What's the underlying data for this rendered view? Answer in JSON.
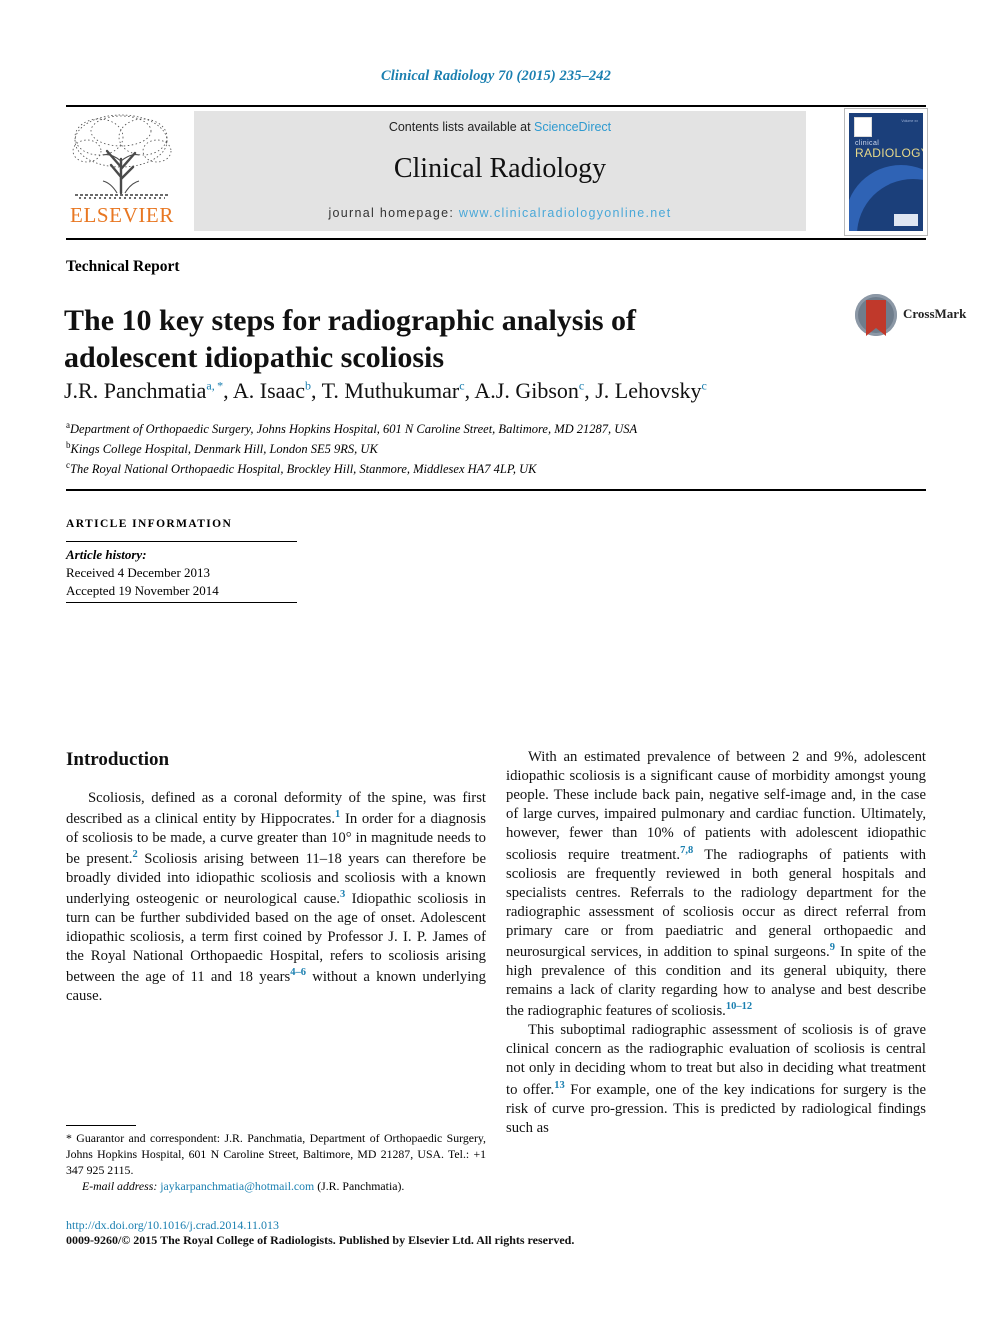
{
  "running_head": "Clinical Radiology 70 (2015) 235–242",
  "masthead": {
    "publisher_name": "ELSEVIER",
    "publisher_logo_name": "elsevier-tree-logo",
    "contents_prefix": "Contents lists available at ",
    "contents_link": "ScienceDirect",
    "journal_name": "Clinical Radiology",
    "homepage_prefix": "journal homepage: ",
    "homepage_url": "www.clinicalradiologyonline.net",
    "cover": {
      "title_small": "clinical",
      "title_large": "RADIOLOGY",
      "corner_note": "Volume xx"
    }
  },
  "article": {
    "type": "Technical Report",
    "title": "The 10 key steps for radiographic analysis of adolescent idiopathic scoliosis",
    "crossmark_label": "CrossMark",
    "authors_html": "J.R. Panchmatia<sup>a, *</sup>, A. Isaac<sup>b</sup>, T. Muthukumar<sup>c</sup>, A.J. Gibson<sup>c</sup>, J. Lehovsky<sup>c</sup>",
    "affiliations": [
      {
        "marker": "a",
        "text": "Department of Orthopaedic Surgery, Johns Hopkins Hospital, 601 N Caroline Street, Baltimore, MD 21287, USA"
      },
      {
        "marker": "b",
        "text": "Kings College Hospital, Denmark Hill, London SE5 9RS, UK"
      },
      {
        "marker": "c",
        "text": "The Royal National Orthopaedic Hospital, Brockley Hill, Stanmore, Middlesex HA7 4LP, UK"
      }
    ]
  },
  "article_information": {
    "heading": "ARTICLE INFORMATION",
    "history_label": "Article history:",
    "received": "Received 4 December 2013",
    "accepted": "Accepted 19 November 2014"
  },
  "body": {
    "section_heading": "Introduction",
    "left_paragraphs_html": [
      "Scoliosis, defined as a coronal deformity of the spine, was first described as a clinical entity by Hippocrates.<sup class=\"ref\">1</sup> In order for a diagnosis of scoliosis to be made, a curve greater than 10&deg; in magnitude needs to be present.<sup class=\"ref\">2</sup> Scoliosis arising between 11&ndash;18 years can therefore be broadly divided into idiopathic scoliosis and scoliosis with a known underlying osteogenic or neurological cause.<sup class=\"ref\">3</sup> Idiopathic scoliosis in turn can be further subdivided based on the age of onset. Adolescent idiopathic scoliosis, a term first coined by Professor J. I. P. James of the Royal National Orthopaedic Hospital, refers to scoliosis arising between the age of 11 and 18 years<sup class=\"ref\">4&ndash;6</sup> without a known underlying cause."
    ],
    "right_paragraphs_html": [
      "With an estimated prevalence of between 2 and 9%, adolescent idiopathic scoliosis is a significant cause of morbidity amongst young people. These include back pain, negative self-image and, in the case of large curves, impaired pulmonary and cardiac function. Ultimately, however, fewer than 10% of patients with adolescent idiopathic scoliosis require treatment.<sup class=\"ref\">7,8</sup> The radiographs of patients with scoliosis are frequently reviewed in both general hospitals and specialists centres. Referrals to the radiology department for the radiographic assessment of scoliosis occur as direct referral from primary care or from paediatric and general orthopaedic and neurosurgical services, in addition to spinal surgeons.<sup class=\"ref\">9</sup> In spite of the high prevalence of this condition and its general ubiquity, there remains a lack of clarity regarding how to analyse and best describe the radiographic features of scoliosis.<sup class=\"ref\">10&ndash;12</sup>",
      "This suboptimal radiographic assessment of scoliosis is of grave clinical concern as the radiographic evaluation of scoliosis is central not only in deciding whom to treat but also in deciding what treatment to offer.<sup class=\"ref\">13</sup> For example, one of the key indications for surgery is the risk of curve pro-gression. This is predicted by radiological findings such as"
    ]
  },
  "footnote": {
    "correspondence_html": "&#42; Guarantor and correspondent: J.R. Panchmatia, Department of Orthopaedic Surgery, Johns Hopkins Hospital, 601 N Caroline Street, Baltimore, MD 21287, USA. Tel.: +1 347 925 2115.",
    "email_label": "E-mail address:",
    "email": "jaykarpanchmatia@hotmail.com",
    "email_attribution": "(J.R. Panchmatia)."
  },
  "footer": {
    "doi": "http://dx.doi.org/10.1016/j.crad.2014.11.013",
    "copyright": "0009-9260/© 2015 The Royal College of Radiologists. Published by Elsevier Ltd. All rights reserved."
  },
  "colors": {
    "link_blue": "#1a7fb0",
    "sciencedirect_blue": "#2e9ad0",
    "elsevier_orange": "#e87722",
    "panel_grey": "#e3e3e3",
    "cover_navy": "#1b3f7a"
  }
}
